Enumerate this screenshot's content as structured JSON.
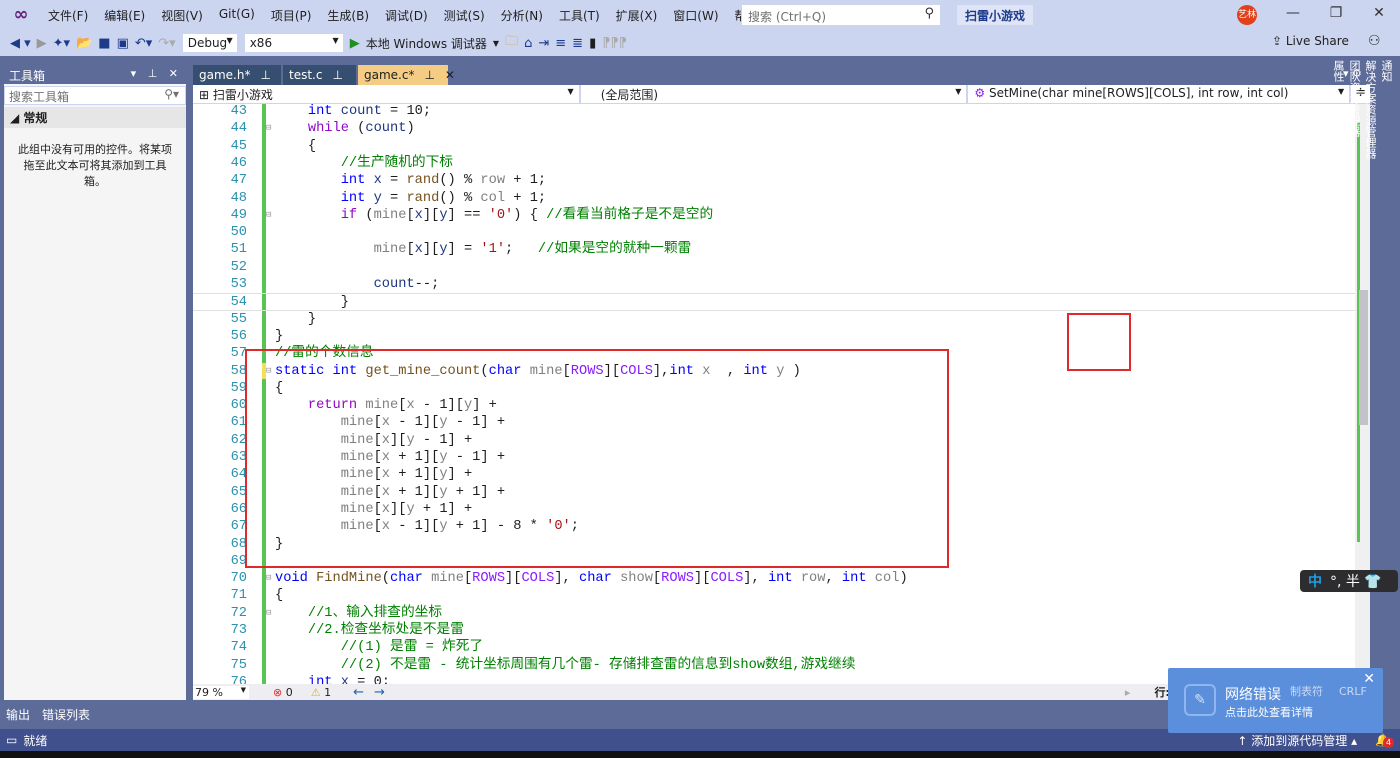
{
  "menu": [
    "文件(F)",
    "编辑(E)",
    "视图(V)",
    "Git(G)",
    "项目(P)",
    "生成(B)",
    "调试(D)",
    "测试(S)",
    "分析(N)",
    "工具(T)",
    "扩展(X)",
    "窗口(W)",
    "帮助(H)"
  ],
  "search": {
    "placeholder": "搜索 (Ctrl+Q)",
    "icon": "search-icon"
  },
  "project_name": "扫雷小游戏",
  "user_avatar": "艺林",
  "toolbar": {
    "config": "Debug",
    "platform": "x86",
    "run_label": "本地 Windows 调试器",
    "live_share": "Live Share"
  },
  "toolbox": {
    "title": "工具箱",
    "search_placeholder": "搜索工具箱",
    "group": "常规",
    "empty_text": "此组中没有可用的控件。将某项拖至此文本可将其添加到工具箱。"
  },
  "tabs": [
    {
      "label": "game.h*",
      "active": false
    },
    {
      "label": "test.c",
      "active": false
    },
    {
      "label": "game.c*",
      "active": true
    }
  ],
  "navbar": {
    "project": "扫雷小游戏",
    "scope": "(全局范围)",
    "member": "SetMine(char mine[ROWS][COLS], int row, int col)"
  },
  "right_sidebar": [
    "通知",
    "解决方案资源管理器",
    "团队资源管理器",
    "属性"
  ],
  "code": {
    "current_line": 54,
    "lines": [
      {
        "n": "43",
        "t": [
          [
            "pl",
            "    "
          ],
          [
            "kw",
            "int"
          ],
          [
            "pl",
            " "
          ],
          [
            "var",
            "count"
          ],
          [
            "pl",
            " = 10;"
          ]
        ]
      },
      {
        "n": "44",
        "t": [
          [
            "pl",
            "    "
          ],
          [
            "ctl2",
            "while"
          ],
          [
            "pl",
            " ("
          ],
          [
            "var",
            "count"
          ],
          [
            "pl",
            ")"
          ]
        ]
      },
      {
        "n": "45",
        "t": [
          [
            "pl",
            "    {"
          ]
        ]
      },
      {
        "n": "46",
        "t": [
          [
            "pl",
            "        "
          ],
          [
            "cmt",
            "//生产随机的下标"
          ]
        ]
      },
      {
        "n": "47",
        "t": [
          [
            "pl",
            "        "
          ],
          [
            "kw",
            "int"
          ],
          [
            "pl",
            " "
          ],
          [
            "var",
            "x"
          ],
          [
            "pl",
            " = "
          ],
          [
            "fn",
            "rand"
          ],
          [
            "pl",
            "() % "
          ],
          [
            "prm",
            "row"
          ],
          [
            "pl",
            " + 1;"
          ]
        ]
      },
      {
        "n": "48",
        "t": [
          [
            "pl",
            "        "
          ],
          [
            "kw",
            "int"
          ],
          [
            "pl",
            " "
          ],
          [
            "var",
            "y"
          ],
          [
            "pl",
            " = "
          ],
          [
            "fn",
            "rand"
          ],
          [
            "pl",
            "() % "
          ],
          [
            "prm",
            "col"
          ],
          [
            "pl",
            " + 1;"
          ]
        ]
      },
      {
        "n": "49",
        "t": [
          [
            "pl",
            "        "
          ],
          [
            "ctl2",
            "if"
          ],
          [
            "pl",
            " ("
          ],
          [
            "prm",
            "mine"
          ],
          [
            "pl",
            "["
          ],
          [
            "var",
            "x"
          ],
          [
            "pl",
            "]["
          ],
          [
            "var",
            "y"
          ],
          [
            "pl",
            "] == "
          ],
          [
            "str",
            "'0'"
          ],
          [
            "pl",
            ") { "
          ],
          [
            "cmt",
            "//看看当前格子是不是空的"
          ]
        ]
      },
      {
        "n": "50",
        "t": []
      },
      {
        "n": "51",
        "t": [
          [
            "pl",
            "            "
          ],
          [
            "prm",
            "mine"
          ],
          [
            "pl",
            "["
          ],
          [
            "var",
            "x"
          ],
          [
            "pl",
            "]["
          ],
          [
            "var",
            "y"
          ],
          [
            "pl",
            "] = "
          ],
          [
            "str",
            "'1'"
          ],
          [
            "pl",
            ";   "
          ],
          [
            "cmt",
            "//如果是空的就种一颗雷"
          ]
        ]
      },
      {
        "n": "52",
        "t": []
      },
      {
        "n": "53",
        "t": [
          [
            "pl",
            "            "
          ],
          [
            "var",
            "count"
          ],
          [
            "pl",
            "--;"
          ]
        ]
      },
      {
        "n": "54",
        "t": [
          [
            "pl",
            "        }"
          ]
        ]
      },
      {
        "n": "55",
        "t": [
          [
            "pl",
            "    }"
          ]
        ]
      },
      {
        "n": "56",
        "t": [
          [
            "pl",
            "}"
          ]
        ]
      },
      {
        "n": "57",
        "t": [
          [
            "cmt",
            "//雷的个数信息"
          ]
        ]
      },
      {
        "n": "58",
        "t": [
          [
            "kw",
            "static"
          ],
          [
            "pl",
            " "
          ],
          [
            "kw",
            "int"
          ],
          [
            "pl",
            " "
          ],
          [
            "fn",
            "get_mine_count"
          ],
          [
            "pl",
            "("
          ],
          [
            "kw",
            "char"
          ],
          [
            "pl",
            " "
          ],
          [
            "prm",
            "mine"
          ],
          [
            "pl",
            "["
          ],
          [
            "mac",
            "ROWS"
          ],
          [
            "pl",
            "]["
          ],
          [
            "mac",
            "COLS"
          ],
          [
            "pl",
            "],"
          ],
          [
            "kw",
            "int"
          ],
          [
            "pl",
            " "
          ],
          [
            "prm",
            "x"
          ],
          [
            "pl",
            "  , "
          ],
          [
            "kw",
            "int"
          ],
          [
            "pl",
            " "
          ],
          [
            "prm",
            "y"
          ],
          [
            "pl",
            " )"
          ]
        ]
      },
      {
        "n": "59",
        "t": [
          [
            "pl",
            "{"
          ]
        ]
      },
      {
        "n": "60",
        "t": [
          [
            "pl",
            "    "
          ],
          [
            "ctl2",
            "return"
          ],
          [
            "pl",
            " "
          ],
          [
            "prm",
            "mine"
          ],
          [
            "pl",
            "["
          ],
          [
            "prm",
            "x"
          ],
          [
            "pl",
            " - 1]["
          ],
          [
            "prm",
            "y"
          ],
          [
            "pl",
            "] +"
          ]
        ]
      },
      {
        "n": "61",
        "t": [
          [
            "pl",
            "        "
          ],
          [
            "prm",
            "mine"
          ],
          [
            "pl",
            "["
          ],
          [
            "prm",
            "x"
          ],
          [
            "pl",
            " - 1]["
          ],
          [
            "prm",
            "y"
          ],
          [
            "pl",
            " - 1] +"
          ]
        ]
      },
      {
        "n": "62",
        "t": [
          [
            "pl",
            "        "
          ],
          [
            "prm",
            "mine"
          ],
          [
            "pl",
            "["
          ],
          [
            "prm",
            "x"
          ],
          [
            "pl",
            "]["
          ],
          [
            "prm",
            "y"
          ],
          [
            "pl",
            " - 1] +"
          ]
        ]
      },
      {
        "n": "63",
        "t": [
          [
            "pl",
            "        "
          ],
          [
            "prm",
            "mine"
          ],
          [
            "pl",
            "["
          ],
          [
            "prm",
            "x"
          ],
          [
            "pl",
            " + 1]["
          ],
          [
            "prm",
            "y"
          ],
          [
            "pl",
            " - 1] +"
          ]
        ]
      },
      {
        "n": "64",
        "t": [
          [
            "pl",
            "        "
          ],
          [
            "prm",
            "mine"
          ],
          [
            "pl",
            "["
          ],
          [
            "prm",
            "x"
          ],
          [
            "pl",
            " + 1]["
          ],
          [
            "prm",
            "y"
          ],
          [
            "pl",
            "] +"
          ]
        ]
      },
      {
        "n": "65",
        "t": [
          [
            "pl",
            "        "
          ],
          [
            "prm",
            "mine"
          ],
          [
            "pl",
            "["
          ],
          [
            "prm",
            "x"
          ],
          [
            "pl",
            " + 1]["
          ],
          [
            "prm",
            "y"
          ],
          [
            "pl",
            " + 1] +"
          ]
        ]
      },
      {
        "n": "66",
        "t": [
          [
            "pl",
            "        "
          ],
          [
            "prm",
            "mine"
          ],
          [
            "pl",
            "["
          ],
          [
            "prm",
            "x"
          ],
          [
            "pl",
            "]["
          ],
          [
            "prm",
            "y"
          ],
          [
            "pl",
            " + 1] +"
          ]
        ]
      },
      {
        "n": "67",
        "t": [
          [
            "pl",
            "        "
          ],
          [
            "prm",
            "mine"
          ],
          [
            "pl",
            "["
          ],
          [
            "prm",
            "x"
          ],
          [
            "pl",
            " - 1]["
          ],
          [
            "prm",
            "y"
          ],
          [
            "pl",
            " + 1] - 8 * "
          ],
          [
            "str",
            "'0'"
          ],
          [
            "pl",
            ";"
          ]
        ]
      },
      {
        "n": "68",
        "t": [
          [
            "pl",
            "}"
          ]
        ]
      },
      {
        "n": "69",
        "t": []
      },
      {
        "n": "70",
        "t": [
          [
            "kw",
            "void"
          ],
          [
            "pl",
            " "
          ],
          [
            "fn",
            "FindMine"
          ],
          [
            "pl",
            "("
          ],
          [
            "kw",
            "char"
          ],
          [
            "pl",
            " "
          ],
          [
            "prm",
            "mine"
          ],
          [
            "pl",
            "["
          ],
          [
            "mac",
            "ROWS"
          ],
          [
            "pl",
            "]["
          ],
          [
            "mac",
            "COLS"
          ],
          [
            "pl",
            "], "
          ],
          [
            "kw",
            "char"
          ],
          [
            "pl",
            " "
          ],
          [
            "prm",
            "show"
          ],
          [
            "pl",
            "["
          ],
          [
            "mac",
            "ROWS"
          ],
          [
            "pl",
            "]["
          ],
          [
            "mac",
            "COLS"
          ],
          [
            "pl",
            "], "
          ],
          [
            "kw",
            "int"
          ],
          [
            "pl",
            " "
          ],
          [
            "prm",
            "row"
          ],
          [
            "pl",
            ", "
          ],
          [
            "kw",
            "int"
          ],
          [
            "pl",
            " "
          ],
          [
            "prm",
            "col"
          ],
          [
            "pl",
            ")"
          ]
        ]
      },
      {
        "n": "71",
        "t": [
          [
            "pl",
            "{"
          ]
        ]
      },
      {
        "n": "72",
        "t": [
          [
            "pl",
            "    "
          ],
          [
            "cmt",
            "//1、输入排查的坐标"
          ]
        ]
      },
      {
        "n": "73",
        "t": [
          [
            "pl",
            "    "
          ],
          [
            "cmt",
            "//2.检查坐标处是不是雷"
          ]
        ]
      },
      {
        "n": "74",
        "t": [
          [
            "pl",
            "        "
          ],
          [
            "cmt",
            "//(1) 是雷 = 炸死了"
          ]
        ]
      },
      {
        "n": "75",
        "t": [
          [
            "pl",
            "        "
          ],
          [
            "cmt",
            "//(2) 不是雷 - 统计坐标周围有几个雷- 存储排查雷的信息到show数组,游戏继续"
          ]
        ]
      },
      {
        "n": "76",
        "t": [
          [
            "pl",
            "    "
          ],
          [
            "kw",
            "int"
          ],
          [
            "pl",
            " "
          ],
          [
            "var",
            "x"
          ],
          [
            "pl",
            " = 0;"
          ]
        ]
      }
    ]
  },
  "editor_bottom": {
    "zoom": "79 %",
    "errors": "0",
    "warnings": "1",
    "line": "行: 54",
    "tabs": "制表符",
    "eol": "CRLF"
  },
  "bottom_panels": [
    "输出",
    "错误列表"
  ],
  "statusbar": {
    "ready": "就绪",
    "source_control": "添加到源代码管理",
    "notifications": "4"
  },
  "ime": {
    "mode": "中",
    "punct": "°,",
    "width": "半"
  },
  "popup": {
    "title": "网络错误",
    "subtitle": "点击此处查看详情"
  },
  "colors": {
    "accent": "#68217a",
    "annotation_box": "#e02a2a",
    "active_tab": "#f5cc84",
    "chrome": "#5d6b99"
  }
}
